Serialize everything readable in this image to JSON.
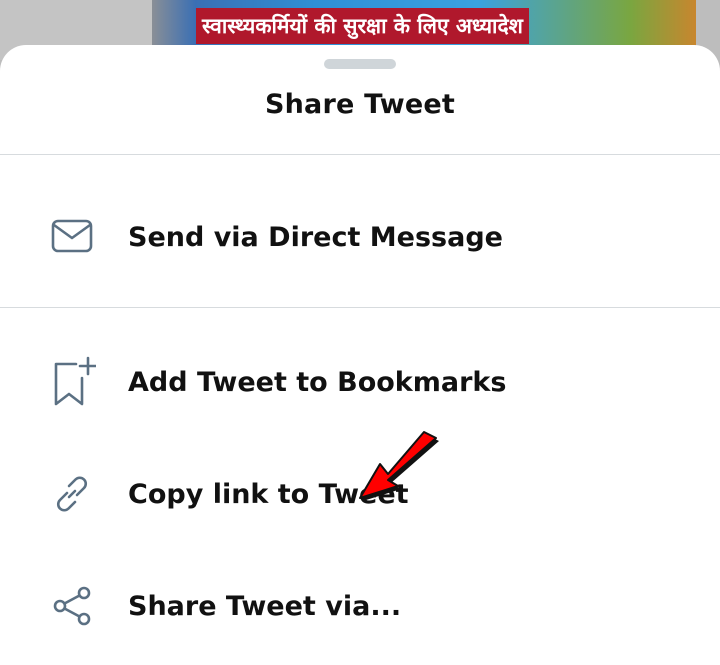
{
  "background": {
    "banner_text": "स्वास्थ्यकर्मियों की सुरक्षा के लिए अध्यादेश"
  },
  "sheet": {
    "title": "Share Tweet",
    "items": [
      {
        "label": "Send via Direct Message",
        "icon": "mail-icon"
      },
      {
        "label": "Add Tweet to Bookmarks",
        "icon": "bookmark-add-icon"
      },
      {
        "label": "Copy link to Tweet",
        "icon": "link-icon"
      },
      {
        "label": "Share Tweet via...",
        "icon": "share-icon"
      }
    ]
  },
  "annotation": {
    "arrow_color": "#ff0000"
  },
  "colors": {
    "icon": "#5b7083",
    "text": "#111111",
    "divider": "#d7dbde"
  }
}
